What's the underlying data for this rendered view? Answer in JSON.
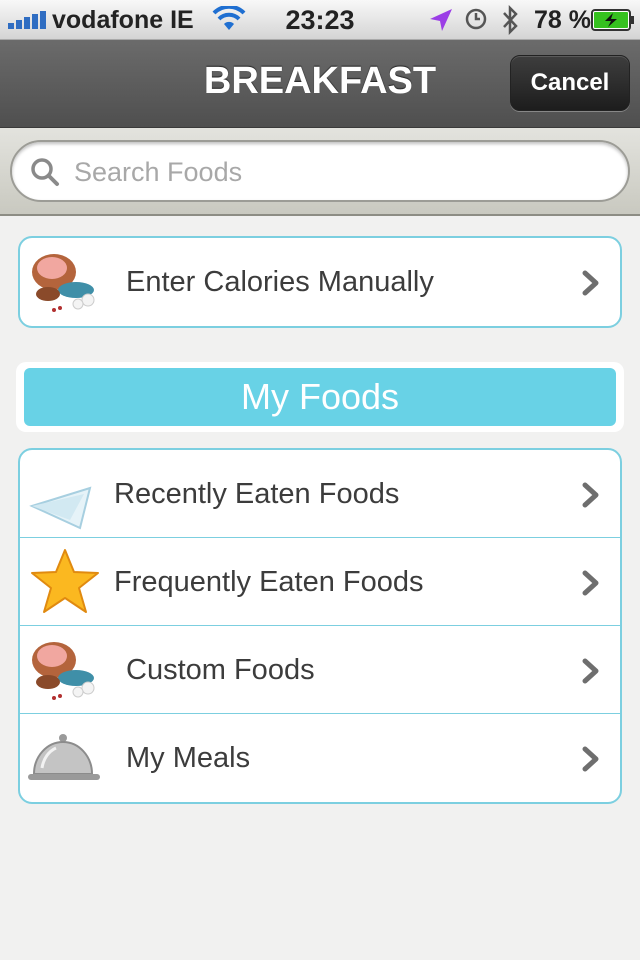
{
  "status_bar": {
    "carrier": "vodafone IE",
    "time": "23:23",
    "battery_percent": "78 %",
    "icons": [
      "signal-bars-icon",
      "wifi-icon",
      "location-arrow-icon",
      "alarm-clock-icon",
      "bluetooth-icon",
      "battery-charging-icon"
    ],
    "location_color": "#9b3ee6",
    "battery_color": "#35c11f"
  },
  "nav": {
    "title": "BREAKFAST",
    "cancel_label": "Cancel"
  },
  "search": {
    "placeholder": "Search Foods",
    "icon": "search-icon"
  },
  "manual_entry": {
    "label": "Enter Calories Manually",
    "icon": "food-platter-icon"
  },
  "my_foods": {
    "header": "My Foods",
    "header_color": "#68d2e6",
    "items": [
      {
        "label": "Recently Eaten Foods",
        "icon": "napkin-icon"
      },
      {
        "label": "Frequently Eaten Foods",
        "icon": "star-icon"
      },
      {
        "label": "Custom Foods",
        "icon": "food-platter-icon"
      },
      {
        "label": "My Meals",
        "icon": "cloche-icon"
      }
    ]
  }
}
